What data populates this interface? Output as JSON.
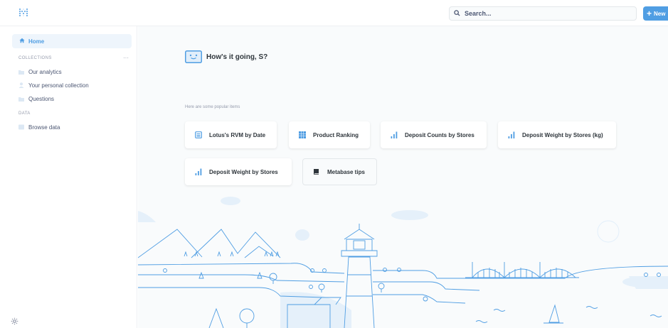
{
  "header": {
    "search_placeholder": "Search...",
    "new_label": "New"
  },
  "sidebar": {
    "home_label": "Home",
    "collections_label": "COLLECTIONS",
    "collections_more": "···",
    "collections": [
      {
        "label": "Our analytics",
        "icon": "folder-icon"
      },
      {
        "label": "Your personal collection",
        "icon": "person-icon"
      },
      {
        "label": "Questions",
        "icon": "folder-icon"
      }
    ],
    "data_label": "DATA",
    "data_items": [
      {
        "label": "Browse data",
        "icon": "database-icon"
      }
    ]
  },
  "main": {
    "greeting": "How's it going, S?",
    "popular_label": "Here are some popular items",
    "items": [
      {
        "label": "Lotus's RVM by Date",
        "icon": "table-icon"
      },
      {
        "label": "Product Ranking",
        "icon": "grid-icon"
      },
      {
        "label": "Deposit Counts by Stores",
        "icon": "bar-chart-icon"
      },
      {
        "label": "Deposit Weight by Stores (kg)",
        "icon": "bar-chart-icon"
      },
      {
        "label": "Deposit Weight by Stores",
        "icon": "bar-chart-icon"
      },
      {
        "label": "Metabase tips",
        "icon": "book-icon"
      }
    ]
  },
  "colors": {
    "brand": "#509ee3",
    "text_dark": "#2e353b",
    "text_medium": "#4c5773",
    "text_light": "#949aab",
    "background": "#f9fbfc"
  }
}
